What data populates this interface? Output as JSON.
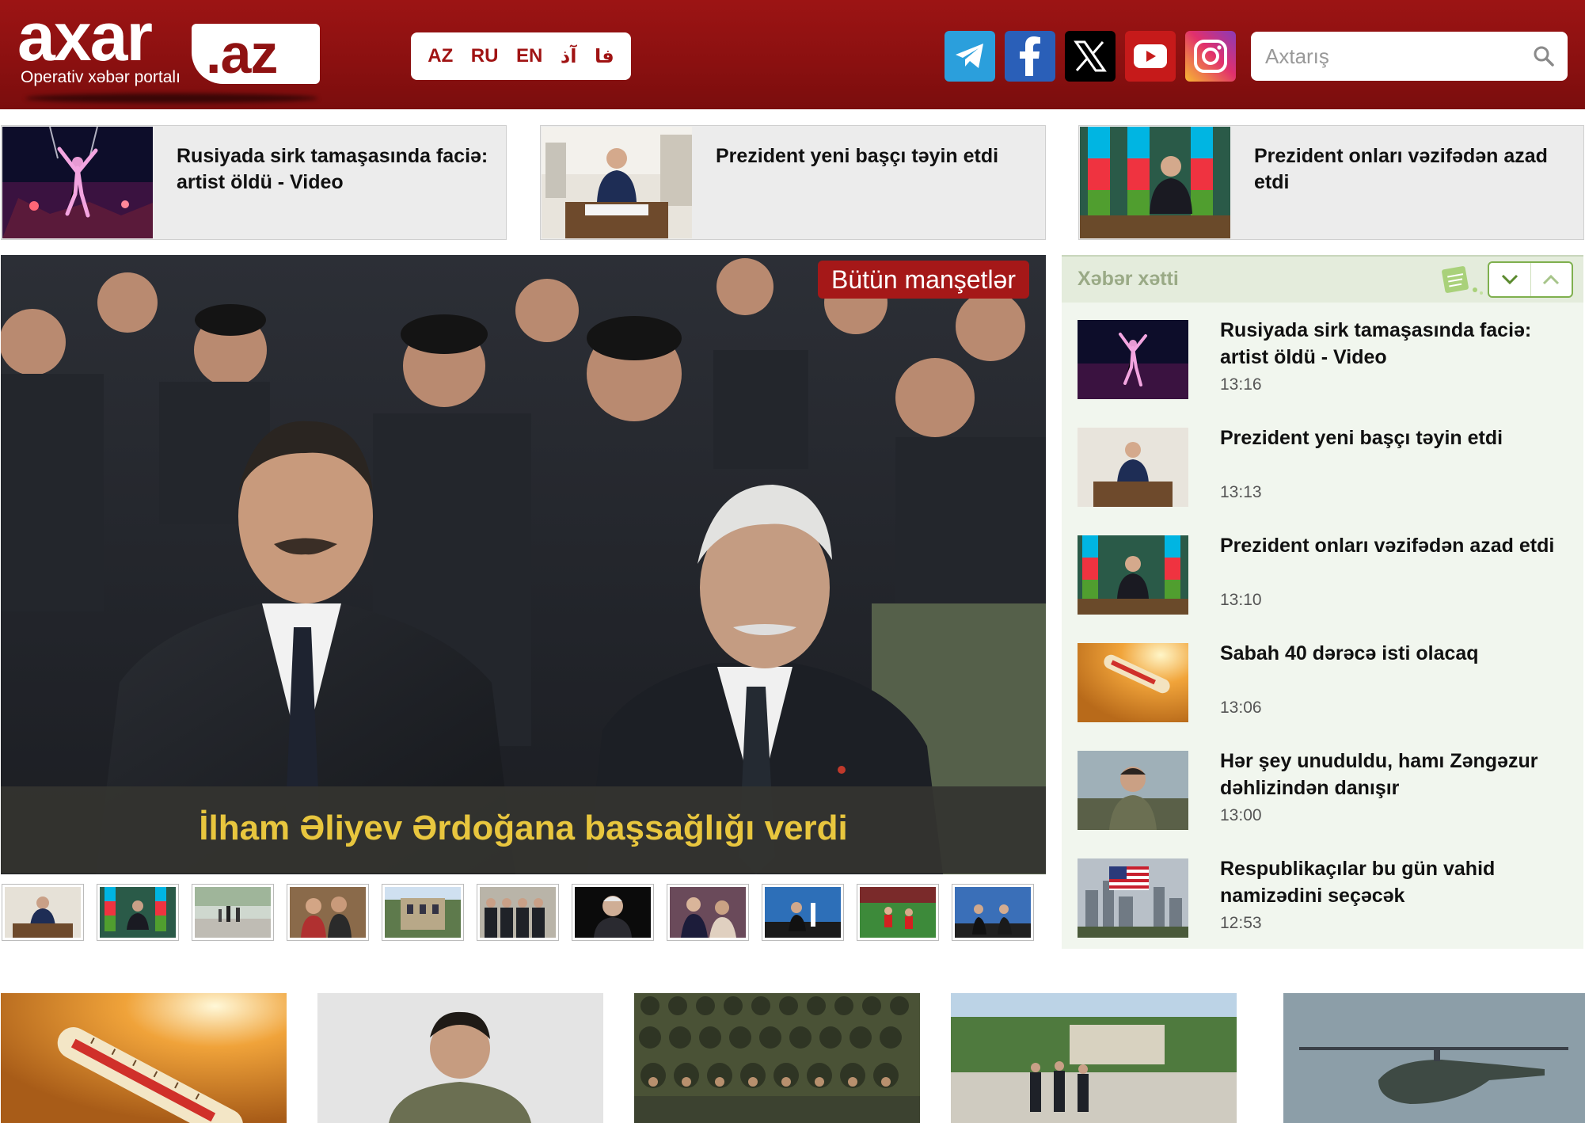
{
  "header": {
    "logo": {
      "brand": "axar",
      "tld": ".az",
      "tagline": "Operativ xəbər portalı"
    },
    "languages": [
      "AZ",
      "RU",
      "EN",
      "آذ",
      "فا"
    ],
    "socials": [
      "telegram-icon",
      "facebook-icon",
      "x-icon",
      "youtube-icon",
      "instagram-icon"
    ],
    "search": {
      "placeholder": "Axtarış",
      "value": ""
    }
  },
  "top_strip": [
    {
      "title": "Rusiyada sirk tamaşasında faciə: artist öldü - Video",
      "image": "circus-performer"
    },
    {
      "title": "Prezident yeni başçı təyin etdi",
      "image": "president-signing"
    },
    {
      "title": "Prezident onları vəzifədən azad etdi",
      "image": "president-flags"
    }
  ],
  "feature": {
    "all_headlines_label": "Bütün manşetlər",
    "caption": "İlham Əliyev Ərdoğana başsağlığı verdi",
    "thumbnails": [
      "president-signing",
      "president-flags",
      "street-walk",
      "two-men",
      "building",
      "officials-row",
      "man-portrait",
      "crowd-handshake",
      "speaker-stage",
      "football-red",
      "stage-speech"
    ]
  },
  "feed": {
    "title": "Xəbər xətti",
    "items": [
      {
        "title": "Rusiyada sirk tamaşasında faciə: artist öldü - Video",
        "time": "13:16",
        "image": "circus-performer"
      },
      {
        "title": "Prezident yeni başçı təyin etdi",
        "time": "13:13",
        "image": "president-signing"
      },
      {
        "title": "Prezident onları vəzifədən azad etdi",
        "time": "13:10",
        "image": "president-flags"
      },
      {
        "title": "Sabah 40 dərəcə isti olacaq",
        "time": "13:06",
        "image": "thermometer"
      },
      {
        "title": "Hər şey unuduldu, hamı Zəngəzur dəhlizindən danışır",
        "time": "13:00",
        "image": "soldier-portrait"
      },
      {
        "title": "Respublikaçılar bu gün vahid namizədini seçəcək",
        "time": "12:53",
        "image": "us-flag-city"
      }
    ]
  },
  "bottom_row": [
    "thermometer",
    "soldier-portrait",
    "army-parade",
    "officials-park",
    "helicopter"
  ],
  "colors": {
    "header_red": "#9c1414",
    "accent_red": "#a51818",
    "caption_gold": "#e8c63e",
    "feed_bg": "#f1f6ee"
  }
}
